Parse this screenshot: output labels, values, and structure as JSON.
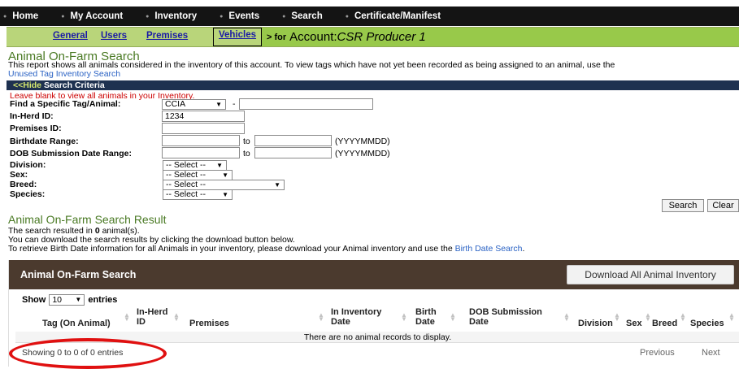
{
  "topnav": [
    "Home",
    "My Account",
    "Inventory",
    "Events",
    "Search",
    "Certificate/Manifest"
  ],
  "subnav": {
    "tabs": [
      "General",
      "Users",
      "Premises"
    ],
    "vehicles": "Vehicles",
    "for_label": "> for",
    "account_prefix": "Account:",
    "account_name": "CSR Producer 1"
  },
  "page": {
    "title": "Animal On-Farm Search",
    "desc": "This report shows all animals considered in the inventory of this account. To view tags which have not yet been recorded as being assigned to an animal, use the",
    "desc_link": "Unused Tag Inventory Search"
  },
  "criteria": {
    "hide_label": "<<Hide",
    "bar_title": "Search Criteria",
    "note": "Leave blank to view all animals in your Inventory.",
    "tag_label": "Find a Specific Tag/Animal:",
    "tag_type": "CCIA",
    "dash": "-",
    "tag_value": "",
    "inherd_label": "In-Herd ID:",
    "inherd_value": "1234",
    "premises_label": "Premises ID:",
    "premises_value": "",
    "birthdate_label": "Birthdate Range:",
    "dob_label": "DOB Submission Date Range:",
    "to": "to",
    "format": "(YYYYMMDD)",
    "division_label": "Division:",
    "sex_label": "Sex:",
    "breed_label": "Breed:",
    "species_label": "Species:",
    "select_text": "-- Select --",
    "search_button": "Search",
    "clear_button": "Clear"
  },
  "result": {
    "title": "Animal On-Farm Search Result",
    "line1_prefix": "The search resulted in",
    "count": "0",
    "line1_suffix": "animal(s).",
    "line2": "You can download the search results by clicking the download button below.",
    "line3": "To retrieve Birth Date information for all Animals in your inventory, please download your Animal inventory and use the",
    "line3_link": "Birth Date Search",
    "line3_end": "."
  },
  "table": {
    "panel_title": "Animal On-Farm Search",
    "download_button": "Download All Animal Inventory",
    "show_label": "Show",
    "page_length": "10",
    "entries_label": "entries",
    "columns": [
      [
        "Tag (On Animal)"
      ],
      [
        "In-Herd",
        "ID"
      ],
      [
        "Premises"
      ],
      [
        "In Inventory",
        "Date"
      ],
      [
        "Birth",
        "Date"
      ],
      [
        "DOB Submission",
        "Date"
      ],
      [
        "Division"
      ],
      [
        "Sex"
      ],
      [
        "Breed"
      ],
      [
        "Species"
      ]
    ],
    "empty_message": "There are no animal records to display.",
    "info": "Showing 0 to 0 of 0 entries",
    "previous": "Previous",
    "next": "Next"
  },
  "colors": {
    "accent_green": "#98c94a",
    "title_green": "#4a7a24",
    "panel_brown": "#4b3a2e",
    "highlight_circle": "#e01010"
  }
}
